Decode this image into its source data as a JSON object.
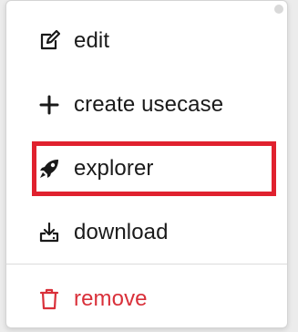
{
  "menu": {
    "items": [
      {
        "label": "edit",
        "icon": "edit-icon"
      },
      {
        "label": "create usecase",
        "icon": "plus-icon"
      },
      {
        "label": "explorer",
        "icon": "rocket-icon"
      },
      {
        "label": "download",
        "icon": "download-icon"
      },
      {
        "label": "remove",
        "icon": "trash-icon"
      }
    ],
    "highlighted_item": "explorer",
    "colors": {
      "text": "#1a1a1a",
      "danger": "#d9303a",
      "highlight_border": "#e0212e"
    }
  }
}
